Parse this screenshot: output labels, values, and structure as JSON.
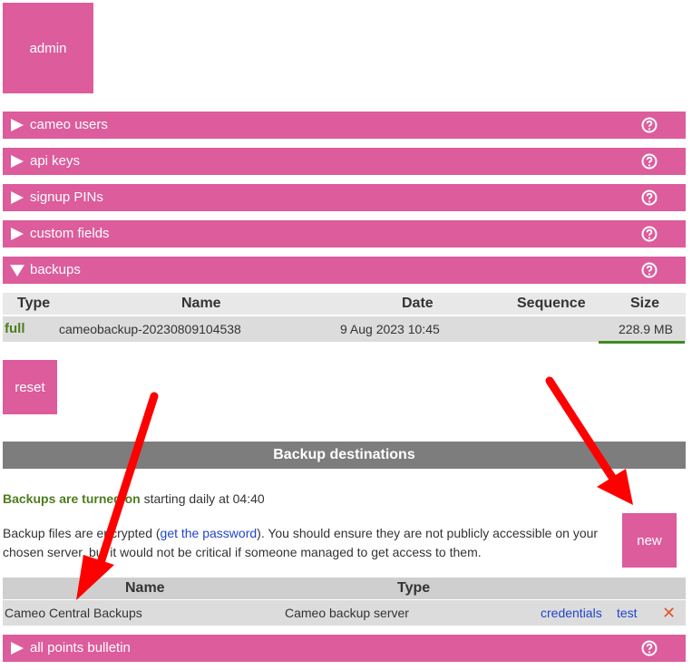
{
  "admin_label": "admin",
  "sections": [
    {
      "label": "cameo users",
      "expanded": false
    },
    {
      "label": "api keys",
      "expanded": false
    },
    {
      "label": "signup PINs",
      "expanded": false
    },
    {
      "label": "custom fields",
      "expanded": false
    },
    {
      "label": "backups",
      "expanded": true
    },
    {
      "label": "all points bulletin",
      "expanded": false
    }
  ],
  "backups": {
    "columns": {
      "type": "Type",
      "name": "Name",
      "date": "Date",
      "sequence": "Sequence",
      "size": "Size"
    },
    "rows": [
      {
        "type": "full",
        "name": "cameobackup-20230809104538",
        "date": "9 Aug 2023 10:45",
        "sequence": "",
        "size": "228.9 MB"
      }
    ],
    "reset_label": "reset"
  },
  "destinations": {
    "title": "Backup destinations",
    "status_on": "Backups are turned on",
    "status_rest": " starting daily at 04:40",
    "note_part1": "Backup files are encrypted (",
    "note_link": "get the password",
    "note_part2": "). You should ensure they are not publicly accessible on your chosen server, but it would not be critical if someone managed to get access to them.",
    "new_label": "new",
    "columns": {
      "name": "Name",
      "type": "Type"
    },
    "rows": [
      {
        "name": "Cameo Central Backups",
        "type": "Cameo backup server",
        "credentials": "credentials",
        "test": "test",
        "delete": "✕"
      }
    ]
  },
  "colors": {
    "accent_pink": "#dc5c9c",
    "status_green": "#4e7d1e",
    "header_grey": "#7d7d7d",
    "link_blue": "#2244cc",
    "annotation_red": "#ff0000"
  },
  "icons": {
    "collapsed": "triangle-right-icon",
    "expanded": "triangle-down-icon",
    "help": "help-circle-icon",
    "delete": "close-icon"
  }
}
